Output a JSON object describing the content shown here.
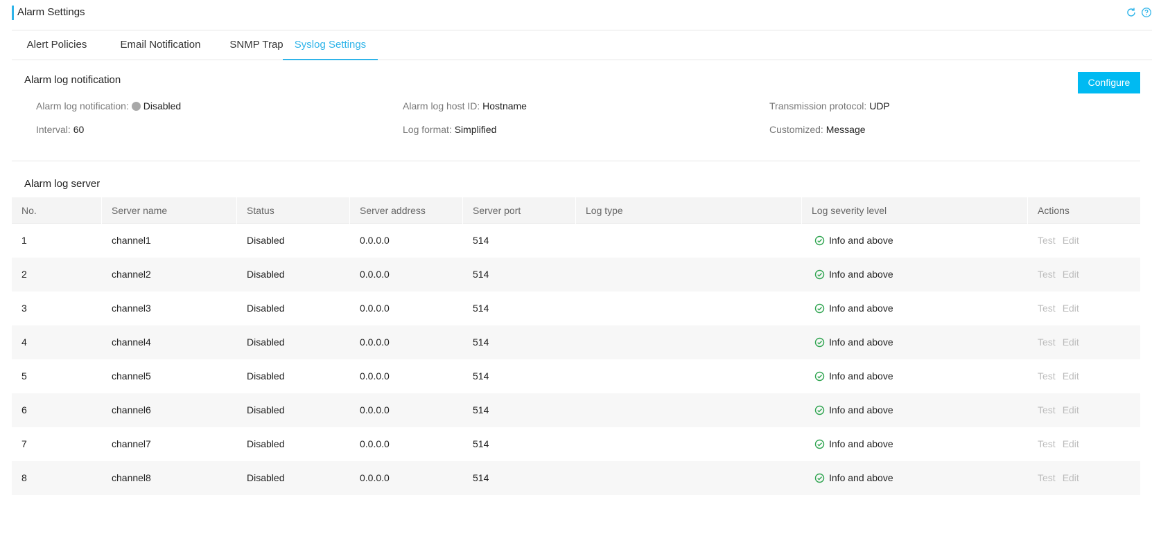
{
  "header": {
    "title": "Alarm Settings",
    "icons": [
      "refresh-icon",
      "help-icon"
    ],
    "accent": "#2fb4e9"
  },
  "tabs": [
    {
      "label": "Alert Policies",
      "active": false
    },
    {
      "label": "Email Notification",
      "active": false
    },
    {
      "label": "SNMP Trap",
      "active": false
    },
    {
      "label": "Syslog Settings",
      "active": true
    }
  ],
  "notification": {
    "title": "Alarm log notification",
    "configure_label": "Configure",
    "fields": {
      "enabled": {
        "label": "Alarm log notification",
        "value": "Disabled"
      },
      "host_id": {
        "label": "Alarm log host ID",
        "value": "Hostname"
      },
      "protocol": {
        "label": "Transmission protocol",
        "value": "UDP"
      },
      "interval": {
        "label": "Interval",
        "value": "60"
      },
      "format": {
        "label": "Log format",
        "value": "Simplified"
      },
      "customized": {
        "label": "Customized",
        "value": "Message"
      }
    }
  },
  "servers": {
    "title": "Alarm log server",
    "columns": [
      "No.",
      "Server name",
      "Status",
      "Server address",
      "Server port",
      "Log type",
      "Log severity level",
      "Actions"
    ],
    "test_label": "Test",
    "edit_label": "Edit",
    "rows": [
      {
        "no": "1",
        "name": "channel1",
        "status": "Disabled",
        "address": "0.0.0.0",
        "port": "514",
        "log_type": "",
        "severity": "Info and above"
      },
      {
        "no": "2",
        "name": "channel2",
        "status": "Disabled",
        "address": "0.0.0.0",
        "port": "514",
        "log_type": "",
        "severity": "Info and above"
      },
      {
        "no": "3",
        "name": "channel3",
        "status": "Disabled",
        "address": "0.0.0.0",
        "port": "514",
        "log_type": "",
        "severity": "Info and above"
      },
      {
        "no": "4",
        "name": "channel4",
        "status": "Disabled",
        "address": "0.0.0.0",
        "port": "514",
        "log_type": "",
        "severity": "Info and above"
      },
      {
        "no": "5",
        "name": "channel5",
        "status": "Disabled",
        "address": "0.0.0.0",
        "port": "514",
        "log_type": "",
        "severity": "Info and above"
      },
      {
        "no": "6",
        "name": "channel6",
        "status": "Disabled",
        "address": "0.0.0.0",
        "port": "514",
        "log_type": "",
        "severity": "Info and above"
      },
      {
        "no": "7",
        "name": "channel7",
        "status": "Disabled",
        "address": "0.0.0.0",
        "port": "514",
        "log_type": "",
        "severity": "Info and above"
      },
      {
        "no": "8",
        "name": "channel8",
        "status": "Disabled",
        "address": "0.0.0.0",
        "port": "514",
        "log_type": "",
        "severity": "Info and above"
      }
    ]
  }
}
